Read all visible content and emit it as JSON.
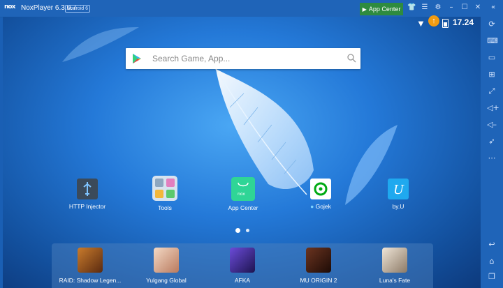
{
  "window": {
    "logo": "nox",
    "title": "NoxPlayer 6.3.0.7",
    "android_badge": "Android 6",
    "app_center_label": "App Center",
    "controls": [
      "shirt-icon",
      "menu-icon",
      "settings-icon",
      "minimize-icon",
      "maximize-icon",
      "close-icon",
      "collapse-sidebar-icon"
    ]
  },
  "status_bar": {
    "clock": "17.24"
  },
  "search": {
    "placeholder": "Search Game, App..."
  },
  "desktop_icons": [
    {
      "label": "HTTP Injector",
      "icon": "http-injector-icon",
      "color": "#3b4a5a"
    },
    {
      "label": "Tools",
      "icon": "tools-folder-icon",
      "color": "#d7e3ef"
    },
    {
      "label": "App Center",
      "icon": "app-center-icon",
      "color": "#2fd596"
    },
    {
      "label": "Gojek",
      "icon": "gojek-icon",
      "color": "#ffffff"
    },
    {
      "label": "by.U",
      "icon": "byu-icon",
      "color": "#1fa9ef"
    }
  ],
  "dock": [
    {
      "label": "RAID: Shadow Legen...",
      "icon": "raid-shadow-legends-icon",
      "color": "#8a4a1e"
    },
    {
      "label": "Yulgang Global",
      "icon": "yulgang-global-icon",
      "color": "#e6c2a8"
    },
    {
      "label": "AFKA",
      "icon": "afka-icon",
      "color": "#3a2a78"
    },
    {
      "label": "MU ORIGIN 2",
      "icon": "mu-origin-2-icon",
      "color": "#3b1d12"
    },
    {
      "label": "Luna's Fate",
      "icon": "lunas-fate-icon",
      "color": "#cfc1b0"
    }
  ],
  "colors": {
    "accent_green": "#2e8b3f",
    "update_badge": "#f29b11",
    "frame_blue": "#1f64b8"
  }
}
